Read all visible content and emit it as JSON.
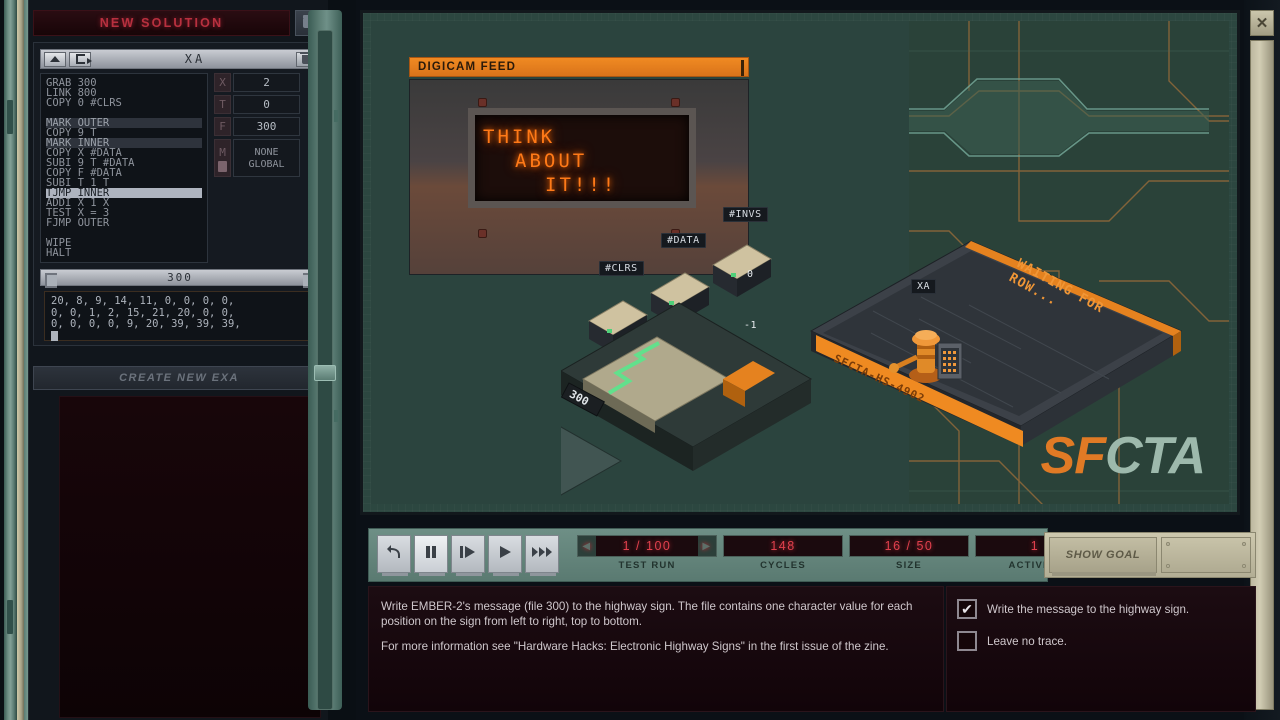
{
  "solution": {
    "new_solution_label": "NEW SOLUTION",
    "folder_icon": "folder-icon"
  },
  "editor": {
    "title": "XA",
    "up_icon": "chevron-up-icon",
    "exit_icon": "door-exit-icon",
    "trash_icon": "trash-icon",
    "code_lines": [
      {
        "text": "GRAB 300",
        "style": "normal"
      },
      {
        "text": "LINK 800",
        "style": "normal"
      },
      {
        "text": "COPY 0 #CLRS",
        "style": "normal"
      },
      {
        "text": "",
        "style": "blank"
      },
      {
        "text": "MARK OUTER",
        "style": "mark"
      },
      {
        "text": "COPY 9 T",
        "style": "normal"
      },
      {
        "text": "MARK INNER",
        "style": "mark"
      },
      {
        "text": "COPY X #DATA",
        "style": "normal"
      },
      {
        "text": "SUBI 9 T #DATA",
        "style": "normal"
      },
      {
        "text": "COPY F #DATA",
        "style": "normal"
      },
      {
        "text": "SUBI T 1 T",
        "style": "normal"
      },
      {
        "text": "TJMP INNER",
        "style": "active"
      },
      {
        "text": "ADDI X 1 X",
        "style": "normal"
      },
      {
        "text": "TEST X = 3",
        "style": "normal"
      },
      {
        "text": "FJMP OUTER",
        "style": "normal"
      },
      {
        "text": "",
        "style": "blank"
      },
      {
        "text": "WIPE",
        "style": "normal"
      },
      {
        "text": "HALT",
        "style": "normal"
      }
    ],
    "registers": [
      {
        "key": "X",
        "value": "2"
      },
      {
        "key": "T",
        "value": "0"
      },
      {
        "key": "F",
        "value": "300"
      }
    ],
    "memory_register": {
      "key": "M",
      "line1": "NONE",
      "line2": "GLOBAL"
    }
  },
  "file_panel": {
    "file_id": "300",
    "rows": [
      "20, 8, 9, 14, 11, 0, 0, 0, 0,",
      "0, 0, 1, 2, 15, 21, 20, 0, 0,",
      "0, 0, 0, 0, 9, 20, 39, 39, 39,"
    ]
  },
  "create_exa_label": "CREATE NEW EXA",
  "digicam": {
    "title": "DIGICAM FEED",
    "sign_lines": [
      "THINK",
      "ABOUT",
      "IT!!!"
    ],
    "sign_color": "#ff7a18"
  },
  "hardware": {
    "registers": [
      "#CLRS",
      "#DATA",
      "#INVS"
    ],
    "exa_name": "XA",
    "status_text": "WAITING FOR ROW...",
    "host_id": "SFCTA-HS-4902",
    "file_label": "300",
    "invs_value": "0",
    "clrs_value": "-1"
  },
  "branding": {
    "logo_part1": "SF",
    "logo_part2": "CTA",
    "color1": "#e07a25",
    "color2": "#9db9ac"
  },
  "controls": {
    "buttons": [
      {
        "name": "reset-button",
        "icon": "undo-icon"
      },
      {
        "name": "pause-button",
        "icon": "pause-icon",
        "selected": true
      },
      {
        "name": "step-button",
        "icon": "step-icon"
      },
      {
        "name": "play-button",
        "icon": "play-icon"
      },
      {
        "name": "fast-forward-button",
        "icon": "fast-forward-icon"
      }
    ],
    "stats": [
      {
        "label": "TEST RUN",
        "value": "1 / 100",
        "has_arrows": true
      },
      {
        "label": "CYCLES",
        "value": "148",
        "has_arrows": false
      },
      {
        "label": "SIZE",
        "value": "16 / 50",
        "has_arrows": false
      },
      {
        "label": "ACTIVITY",
        "value": "1",
        "has_arrows": false
      }
    ]
  },
  "goal": {
    "show_goal_label": "SHOW GOAL"
  },
  "objective": {
    "paragraph1": "Write EMBER-2's message (file 300) to the highway sign. The file contains one character value for each position on the sign from left to right, top to bottom.",
    "paragraph2": "For more information see \"Hardware Hacks: Electronic Highway Signs\" in the first issue of the zine.",
    "checks": [
      {
        "label": "Write the message to the highway sign.",
        "checked": true,
        "mark": "✔"
      },
      {
        "label": "Leave no trace.",
        "checked": false,
        "mark": ""
      }
    ]
  },
  "window": {
    "close_label": "✕"
  }
}
